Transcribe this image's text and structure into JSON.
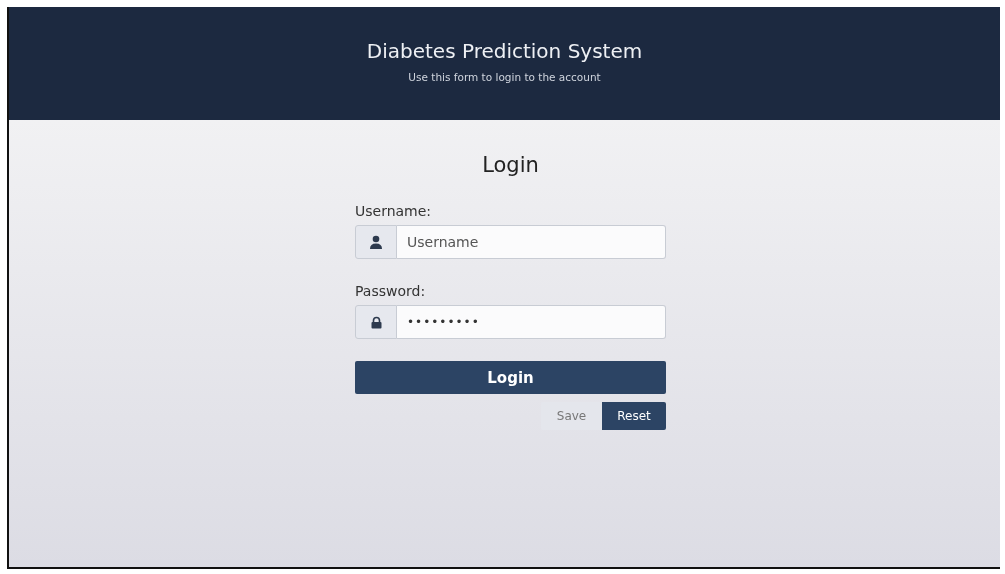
{
  "header": {
    "title": "Diabetes Prediction System",
    "subtitle": "Use this form to login to the account"
  },
  "form": {
    "title": "Login",
    "fields": [
      {
        "label": "Username:",
        "kind": "user",
        "placeholder": "Username"
      },
      {
        "label": "Password:",
        "kind": "lock",
        "value": "•••••••••"
      }
    ],
    "submit": "Login",
    "buttons": [
      {
        "label": "Save",
        "kind": "light"
      },
      {
        "label": "Reset",
        "kind": "dark"
      }
    ]
  }
}
